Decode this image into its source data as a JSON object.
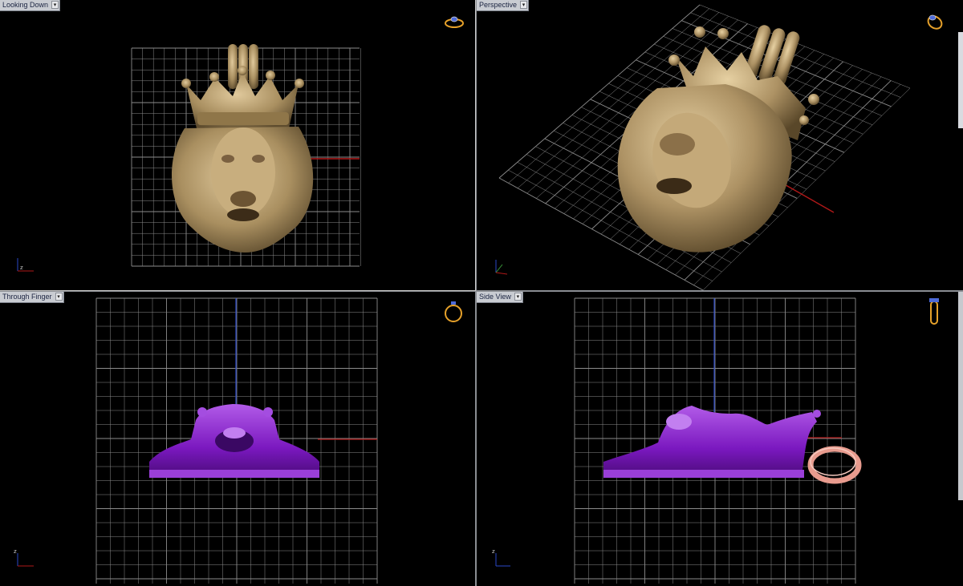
{
  "viewports": [
    {
      "id": "looking-down",
      "title": "Looking Down",
      "axis_labels": {
        "vertical": "y",
        "horizontal": "x",
        "origin": "z"
      }
    },
    {
      "id": "perspective",
      "title": "Perspective",
      "axis_labels": {
        "vertical": "z",
        "horizontal": "x",
        "origin": "y"
      }
    },
    {
      "id": "through-finger",
      "title": "Through Finger",
      "axis_labels": {
        "vertical": "z",
        "horizontal": "x",
        "origin": ""
      }
    },
    {
      "id": "side-view",
      "title": "Side View",
      "axis_labels": {
        "vertical": "z",
        "horizontal": "y",
        "origin": ""
      }
    }
  ],
  "icons": {
    "top_left": "ring-top-icon",
    "top_right": "ring-perspective-icon",
    "bottom_left": "ring-front-icon",
    "bottom_right": "ring-side-icon"
  },
  "colors": {
    "background": "#000000",
    "grid": "#8c8c8c",
    "model_gold": "#b49a6c",
    "model_purple": "#8a1fc6",
    "axis_red": "#b01818",
    "axis_blue": "#2a48c8",
    "bail_ring": "#e89b8e",
    "tab_bg": "#c9ccd2"
  }
}
